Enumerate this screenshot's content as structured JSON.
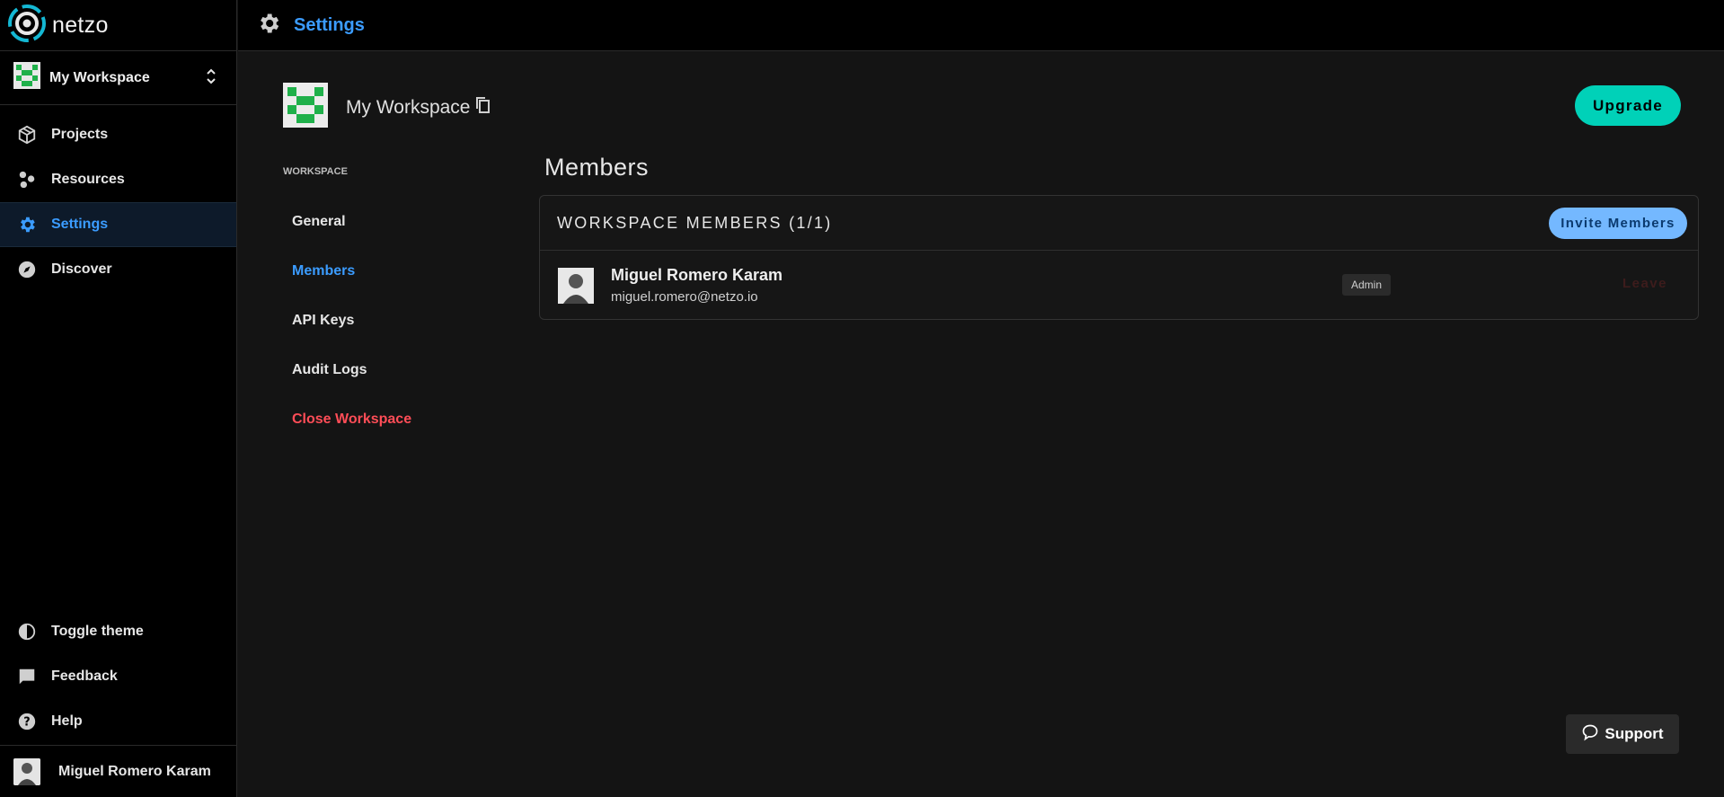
{
  "brand": {
    "name": "netzo",
    "accent": "#3b9cff",
    "logo_color": "#14b8d4"
  },
  "workspace_switcher": {
    "name": "My Workspace"
  },
  "nav": {
    "items": [
      {
        "label": "Projects",
        "icon": "cube-icon"
      },
      {
        "label": "Resources",
        "icon": "resources-icon"
      },
      {
        "label": "Settings",
        "icon": "gear-icon",
        "active": true
      },
      {
        "label": "Discover",
        "icon": "compass-icon"
      }
    ],
    "bottom": [
      {
        "label": "Toggle theme",
        "icon": "contrast-icon"
      },
      {
        "label": "Feedback",
        "icon": "comment-icon"
      },
      {
        "label": "Help",
        "icon": "help-icon"
      }
    ]
  },
  "user": {
    "name": "Miguel Romero Karam"
  },
  "topbar": {
    "title": "Settings"
  },
  "workspace_header": {
    "name": "My Workspace",
    "upgrade_label": "Upgrade"
  },
  "subnav": {
    "section": "WORKSPACE",
    "items": [
      {
        "label": "General"
      },
      {
        "label": "Members",
        "active": true
      },
      {
        "label": "API Keys"
      },
      {
        "label": "Audit Logs"
      },
      {
        "label": "Close Workspace",
        "danger": true
      }
    ]
  },
  "members_page": {
    "title": "Members",
    "card_title": "WORKSPACE MEMBERS (1/1)",
    "invite_label": "Invite Members",
    "members": [
      {
        "name": "Miguel Romero Karam",
        "email": "miguel.romero@netzo.io",
        "role": "Admin",
        "action": "Leave"
      }
    ]
  },
  "support": {
    "label": "Support"
  }
}
